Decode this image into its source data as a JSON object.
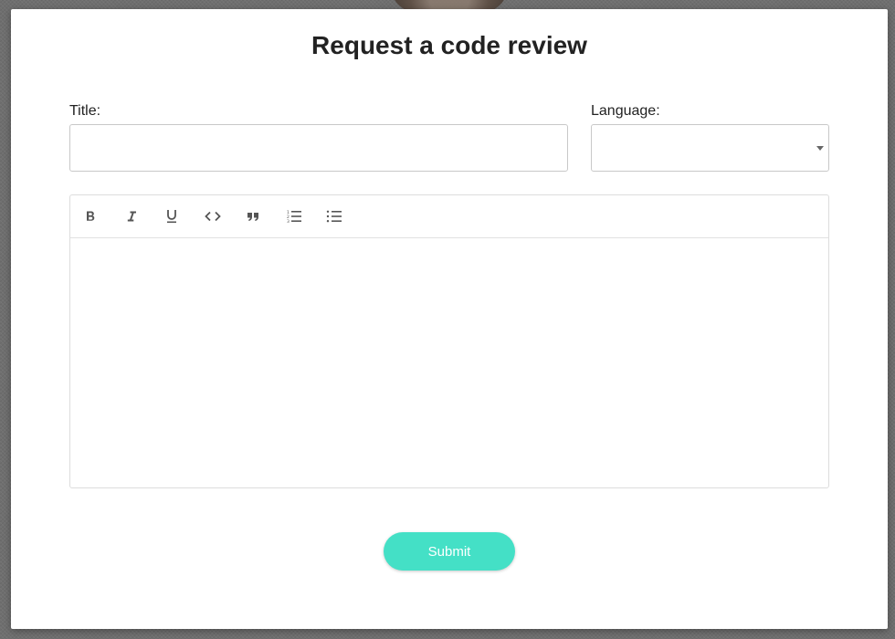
{
  "modal": {
    "title": "Request a code review"
  },
  "form": {
    "title_label": "Title:",
    "title_value": "",
    "title_placeholder": "",
    "language_label": "Language:",
    "language_value": ""
  },
  "editor": {
    "toolbar": [
      {
        "name": "bold",
        "icon": "bold-icon"
      },
      {
        "name": "italic",
        "icon": "italic-icon"
      },
      {
        "name": "underline",
        "icon": "underline-icon"
      },
      {
        "name": "code",
        "icon": "code-icon"
      },
      {
        "name": "blockquote",
        "icon": "quote-icon"
      },
      {
        "name": "ordered-list",
        "icon": "ordered-list-icon"
      },
      {
        "name": "bullet-list",
        "icon": "bullet-list-icon"
      }
    ],
    "content": ""
  },
  "actions": {
    "submit_label": "Submit"
  },
  "colors": {
    "accent": "#44e0c6",
    "text": "#222222",
    "border": "#c8c8c8",
    "icon": "#555555",
    "overlay": "#6f6f6f"
  }
}
